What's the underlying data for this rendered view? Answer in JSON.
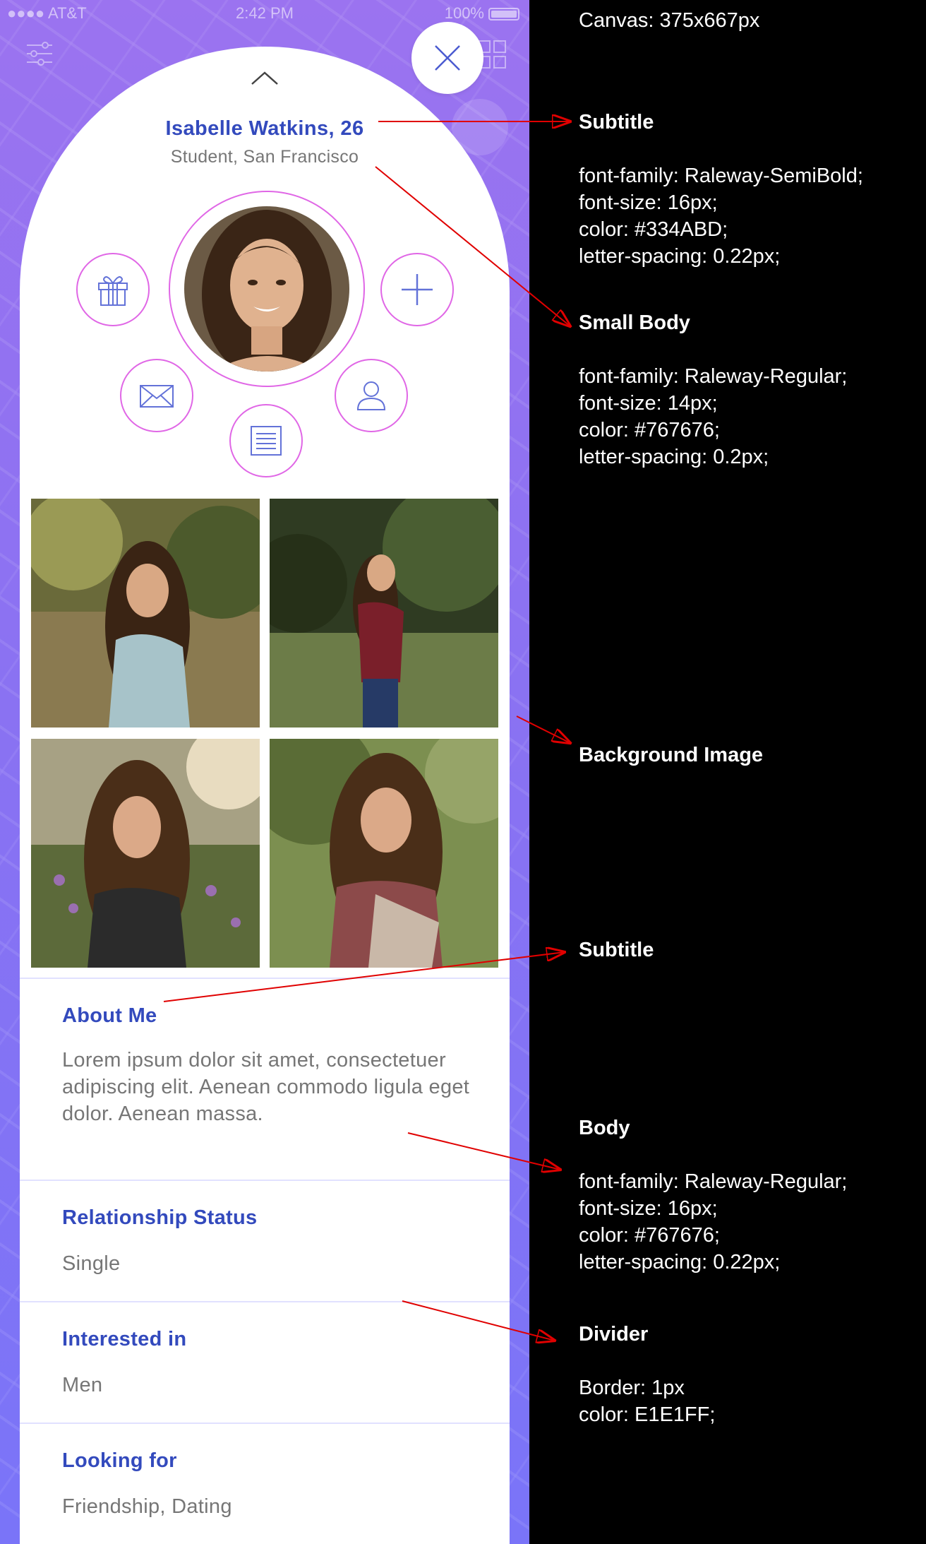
{
  "status_bar": {
    "carrier": "●●●● AT&T",
    "time": "2:42 PM",
    "battery": "100%"
  },
  "profile": {
    "name": "Isabelle Watkins, 26",
    "subtitle": "Student, San Francisco"
  },
  "actions": [
    "gift-icon",
    "plus-icon",
    "mail-icon",
    "person-icon",
    "document-icon"
  ],
  "sections": [
    {
      "title": "About Me",
      "body": "Lorem ipsum dolor sit amet, consectetuer adipiscing elit. Aenean commodo ligula eget dolor. Aenean massa."
    },
    {
      "title": "Relationship Status",
      "body": "Single"
    },
    {
      "title": "Interested in",
      "body": "Men"
    },
    {
      "title": "Looking for",
      "body": "Friendship, Dating"
    }
  ],
  "annotations": {
    "canvas": "Canvas: 375x667px",
    "subtitle1": {
      "title": "Subtitle",
      "lines": [
        "font-family: Raleway-SemiBold;",
        "font-size: 16px;",
        "color: #334ABD;",
        "letter-spacing: 0.22px;"
      ]
    },
    "small_body": {
      "title": "Small Body",
      "lines": [
        "font-family: Raleway-Regular;",
        "font-size: 14px;",
        "color: #767676;",
        "letter-spacing: 0.2px;"
      ]
    },
    "background_image": {
      "title": "Background Image"
    },
    "subtitle2": {
      "title": "Subtitle"
    },
    "body": {
      "title": "Body",
      "lines": [
        "font-family: Raleway-Regular;",
        "font-size: 16px;",
        "color: #767676;",
        "letter-spacing: 0.22px;"
      ]
    },
    "divider": {
      "title": "Divider",
      "lines": [
        "Border: 1px",
        "color: E1E1FF;"
      ]
    }
  },
  "colors": {
    "accent": "#334ABD",
    "body_text": "#767676",
    "divider": "#E1E1FF",
    "ring": "#E067E6",
    "annotation_arrow": "#E00000"
  }
}
